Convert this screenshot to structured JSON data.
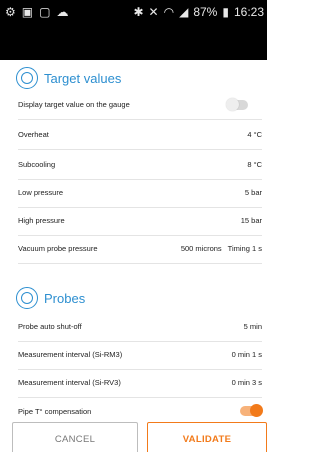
{
  "statusbar": {
    "left_icons": [
      "android-icon",
      "image-icon",
      "screenshot-icon",
      "cloud-icon"
    ],
    "right_icons": [
      "bluetooth-icon",
      "mute-icon",
      "wifi-icon",
      "signal-icon"
    ],
    "battery": "87%",
    "time": "16:23"
  },
  "target_values": {
    "title": "Target values",
    "display_on_gauge": {
      "label": "Display target value on the gauge",
      "enabled": false
    },
    "overheat": {
      "label": "Overheat",
      "value": "4 °C"
    },
    "subcooling": {
      "label": "Subcooling",
      "value": "8 °C"
    },
    "low_pressure": {
      "label": "Low pressure",
      "value": "5 bar"
    },
    "high_pressure": {
      "label": "High pressure",
      "value": "15 bar"
    },
    "vacuum": {
      "label": "Vacuum probe pressure",
      "value": "500 microns",
      "timing": "Timing 1 s"
    }
  },
  "probes": {
    "title": "Probes",
    "auto_shutoff": {
      "label": "Probe auto shut-off",
      "value": "5 min"
    },
    "interval_rm3": {
      "label": "Measurement interval (Si-RM3)",
      "value": "0 min 1 s"
    },
    "interval_rv3": {
      "label": "Measurement interval (Si-RV3)",
      "value": "0 min 3 s"
    },
    "pipe_comp": {
      "label": "Pipe T° compensation",
      "enabled": true
    }
  },
  "footer": {
    "cancel_label": "CANCEL",
    "validate_label": "VALIDATE"
  },
  "colors": {
    "accent": "#2d8fd0",
    "orange": "#f27a1a"
  }
}
